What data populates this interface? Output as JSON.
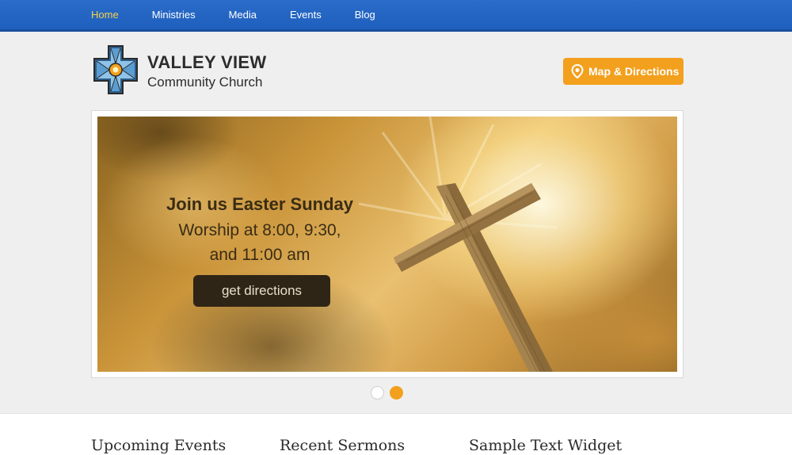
{
  "nav": {
    "items": [
      {
        "label": "Home",
        "active": true
      },
      {
        "label": "Ministries",
        "active": false
      },
      {
        "label": "Media",
        "active": false
      },
      {
        "label": "Events",
        "active": false
      },
      {
        "label": "Blog",
        "active": false
      }
    ]
  },
  "header": {
    "title": "VALLEY VIEW",
    "subtitle": "Community Church",
    "logo_icon": "stained-glass-cross-icon",
    "map_button": {
      "label": "Map & Directions",
      "icon": "map-pin-icon"
    }
  },
  "slider": {
    "heading": "Join us Easter Sunday",
    "line1": "Worship at 8:00, 9:30,",
    "line2": "and 11:00 am",
    "button_label": "get directions",
    "slide_count": 2,
    "active_slide": 2
  },
  "widgets": [
    {
      "title": "Upcoming Events"
    },
    {
      "title": "Recent Sermons"
    },
    {
      "title": "Sample Text Widget"
    }
  ],
  "colors": {
    "nav_bg": "#1f5fbd",
    "nav_active": "#f5d34a",
    "accent": "#f2a01d",
    "page_bg": "#efefef"
  }
}
